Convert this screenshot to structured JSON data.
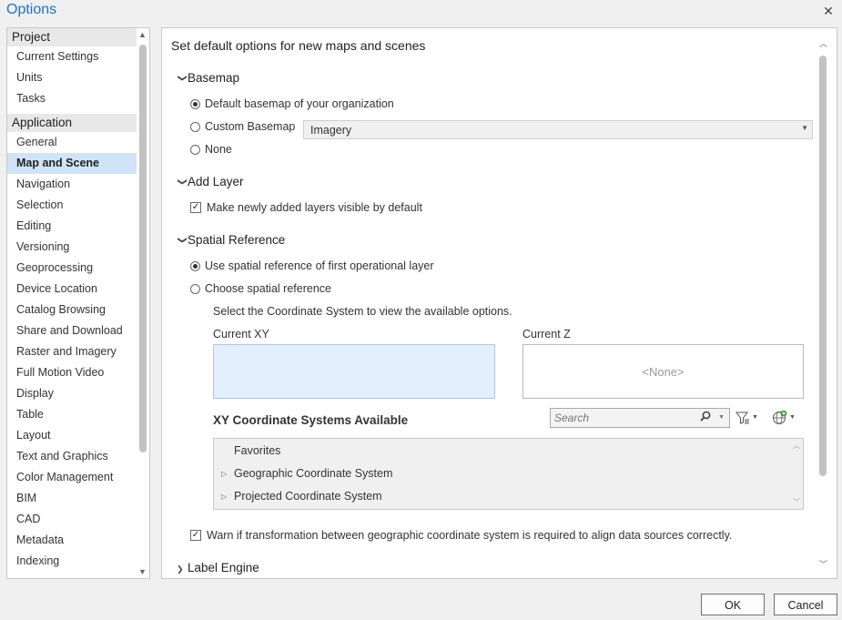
{
  "window": {
    "title": "Options",
    "close_glyph": "✕"
  },
  "nav": {
    "groups": [
      {
        "label": "Project",
        "items": [
          "Current Settings",
          "Units",
          "Tasks"
        ]
      },
      {
        "label": "Application",
        "items": [
          "General",
          "Map and Scene",
          "Navigation",
          "Selection",
          "Editing",
          "Versioning",
          "Geoprocessing",
          "Device Location",
          "Catalog Browsing",
          "Share and Download",
          "Raster and Imagery",
          "Full Motion Video",
          "Display",
          "Table",
          "Layout",
          "Text and Graphics",
          "Color Management",
          "BIM",
          "CAD",
          "Metadata",
          "Indexing"
        ]
      }
    ],
    "selected": "Map and Scene"
  },
  "main": {
    "heading": "Set default options for new maps and scenes",
    "basemap": {
      "title": "Basemap",
      "options": [
        "Default basemap of your organization",
        "Custom Basemap",
        "None"
      ],
      "selected_index": 0,
      "custom_value": "Imagery"
    },
    "add_layer": {
      "title": "Add Layer",
      "visible_label": "Make newly added layers visible by default",
      "visible_checked": true
    },
    "spatial_reference": {
      "title": "Spatial Reference",
      "options": [
        "Use spatial reference of first operational layer",
        "Choose spatial reference"
      ],
      "selected_index": 0,
      "hint": "Select the Coordinate System to view the available options.",
      "current_xy_label": "Current XY",
      "current_z_label": "Current Z",
      "current_z_value": "<None>",
      "available_title": "XY Coordinate Systems Available",
      "search_placeholder": "Search",
      "tree_items": [
        "Favorites",
        "Geographic Coordinate System",
        "Projected Coordinate System"
      ],
      "warn_label": "Warn if transformation between geographic coordinate system is required to align data sources correctly.",
      "warn_checked": true
    },
    "label_engine": {
      "title": "Label Engine"
    }
  },
  "footer": {
    "ok_label": "OK",
    "cancel_label": "Cancel"
  },
  "icons": {
    "search": "search-icon",
    "filter": "filter-icon",
    "globe": "globe-add-icon"
  }
}
